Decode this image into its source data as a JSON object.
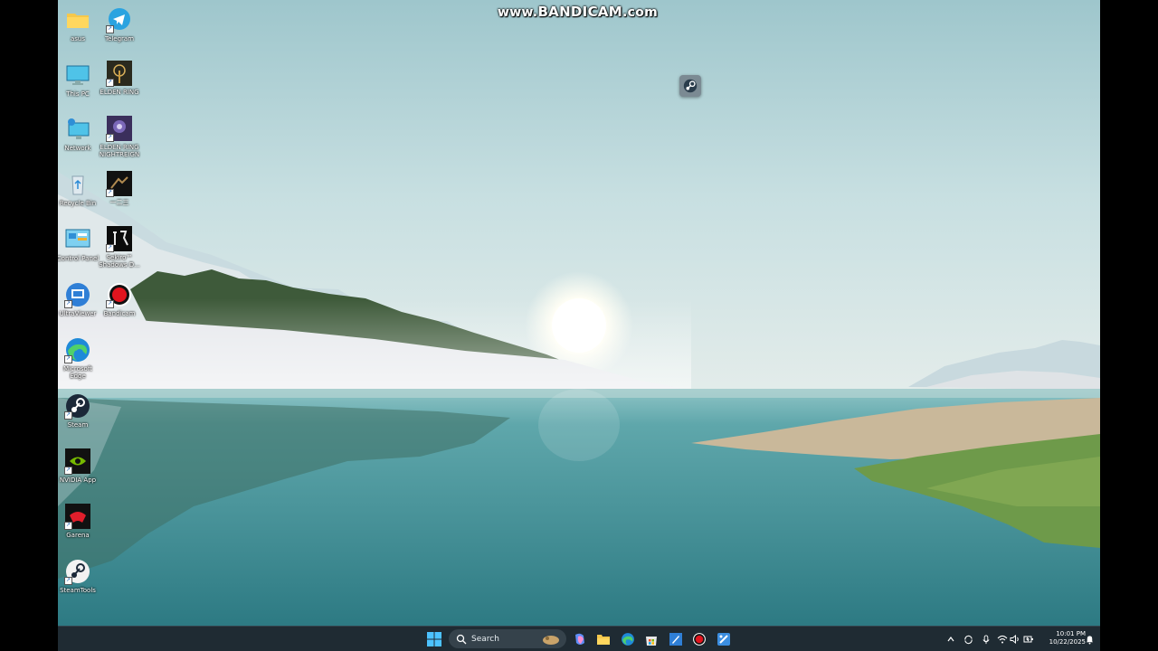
{
  "watermark": {
    "prefix": "www.",
    "brand": "BANDICAM",
    "suffix": ".com"
  },
  "desktop": {
    "icons": [
      {
        "id": "asus",
        "label": "asus",
        "icon": "folder-icon"
      },
      {
        "id": "telegram",
        "label": "Telegram",
        "icon": "telegram-icon"
      },
      {
        "id": "this-pc",
        "label": "This PC",
        "icon": "monitor-icon"
      },
      {
        "id": "elden-ring",
        "label": "ELDEN RING",
        "icon": "elden-ring-icon"
      },
      {
        "id": "network",
        "label": "Network",
        "icon": "network-icon"
      },
      {
        "id": "elden-ring-nightreign",
        "label": "ELDEN RING\nNIGHTREIGN",
        "icon": "nightreign-icon"
      },
      {
        "id": "recycle-bin",
        "label": "Recycle Bin",
        "icon": "recycle-bin-icon"
      },
      {
        "id": "game-cn",
        "label": "一二三",
        "icon": "game-icon"
      },
      {
        "id": "control-panel",
        "label": "Control Panel",
        "icon": "control-panel-icon"
      },
      {
        "id": "sekiro",
        "label": "Sekiro™\nShadows D...",
        "icon": "sekiro-icon"
      },
      {
        "id": "ultraviewer",
        "label": "UltraViewer",
        "icon": "ultraviewer-icon"
      },
      {
        "id": "bandicam",
        "label": "Bandicam",
        "icon": "bandicam-icon"
      },
      {
        "id": "edge",
        "label": "Microsoft\nEdge",
        "icon": "edge-icon"
      },
      {
        "id": "steam",
        "label": "Steam",
        "icon": "steam-icon"
      },
      {
        "id": "nvidia",
        "label": "NVIDIA App",
        "icon": "nvidia-icon"
      },
      {
        "id": "garena",
        "label": "Garena",
        "icon": "garena-icon"
      },
      {
        "id": "steamtools",
        "label": "SteamTools",
        "icon": "steamtools-icon"
      }
    ]
  },
  "taskbar": {
    "search_label": "Search",
    "apps": [
      "start-icon",
      "search-icon",
      "copilot-icon",
      "file-explorer-icon",
      "edge-icon",
      "store-icon",
      "paint-icon",
      "bandicam-icon",
      "snipping-icon"
    ],
    "tray": [
      "chevron-up-icon",
      "sync-icon",
      "microphone-icon",
      "wifi-icon",
      "volume-icon",
      "battery-icon",
      "notification-icon"
    ],
    "time": "10:01 PM",
    "date": "10/22/2025"
  },
  "colors": {
    "taskbar": "#1f2b33",
    "sky": "#b8d8dd",
    "water": "#3e8e95"
  }
}
